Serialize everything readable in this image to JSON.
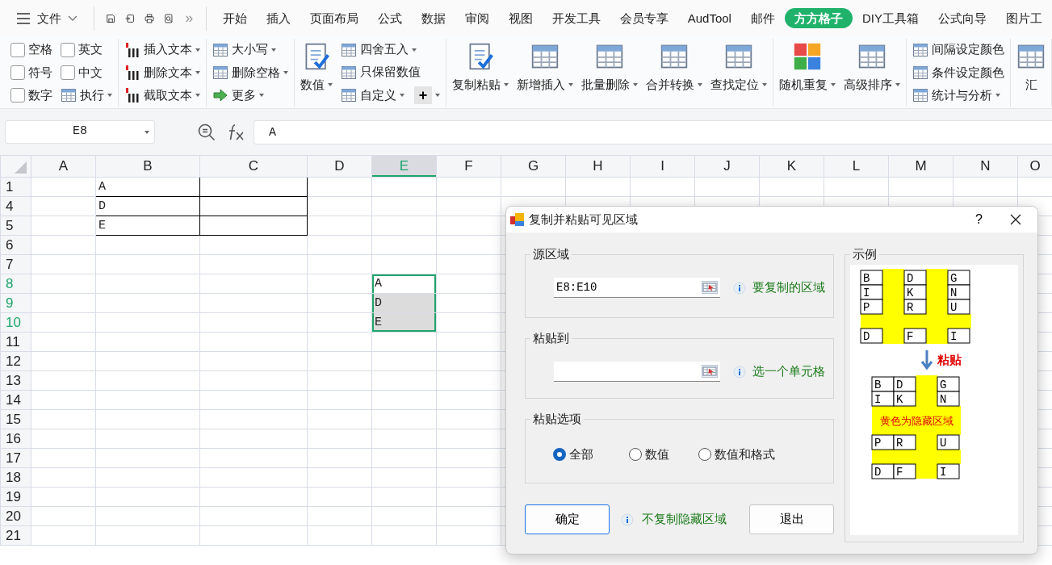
{
  "tab_bar": {
    "file_menu": "文件",
    "more": "»",
    "tabs": [
      {
        "label": "开始",
        "selected": false
      },
      {
        "label": "插入",
        "selected": false
      },
      {
        "label": "页面布局",
        "selected": false
      },
      {
        "label": "公式",
        "selected": false
      },
      {
        "label": "数据",
        "selected": false
      },
      {
        "label": "审阅",
        "selected": false
      },
      {
        "label": "视图",
        "selected": false
      },
      {
        "label": "开发工具",
        "selected": false
      },
      {
        "label": "会员专享",
        "selected": false
      },
      {
        "label": "AudTool",
        "selected": false
      },
      {
        "label": "邮件",
        "selected": false
      },
      {
        "label": "方方格子",
        "selected": true
      },
      {
        "label": "DIY工具箱",
        "selected": false
      },
      {
        "label": "公式向导",
        "selected": false
      },
      {
        "label": "图片工",
        "selected": false
      }
    ]
  },
  "ribbon": {
    "groups": [
      {
        "columns": [
          [
            {
              "kind": "check",
              "label": "空格",
              "checked": false
            },
            {
              "kind": "check",
              "label": "符号",
              "checked": false
            },
            {
              "kind": "check",
              "label": "数字",
              "checked": false
            }
          ],
          [
            {
              "kind": "check",
              "label": "英文",
              "checked": false
            },
            {
              "kind": "check",
              "label": "中文",
              "checked": false
            },
            {
              "kind": "small",
              "label": "执行",
              "dropdown": true
            }
          ]
        ]
      },
      {
        "columns": [
          [
            {
              "kind": "small",
              "label": "插入文本",
              "dropdown": true
            },
            {
              "kind": "small",
              "label": "删除文本",
              "dropdown": true
            },
            {
              "kind": "small",
              "label": "截取文本",
              "dropdown": true
            }
          ]
        ]
      },
      {
        "columns": [
          [
            {
              "kind": "small",
              "label": "大小写",
              "dropdown": true
            },
            {
              "kind": "small",
              "label": "删除空格",
              "dropdown": true
            },
            {
              "kind": "small",
              "label": "更多",
              "dropdown": true
            }
          ]
        ]
      },
      {
        "columns": [
          [
            {
              "kind": "large",
              "label": "数值",
              "dropdown": true
            }
          ],
          [
            {
              "kind": "small",
              "label": "四舍五入",
              "dropdown": true
            },
            {
              "kind": "small",
              "label": "只保留数值",
              "dropdown": false
            },
            {
              "kind": "pair",
              "items": [
                {
                  "kind": "small",
                  "label": "自定义",
                  "dropdown": true
                },
                {
                  "kind": "symbol",
                  "label": "+",
                  "dropdown": true
                }
              ]
            }
          ]
        ]
      },
      {
        "columns": [
          [
            {
              "kind": "large",
              "label": "复制粘贴",
              "dropdown": true
            }
          ],
          [
            {
              "kind": "large",
              "label": "新增插入",
              "dropdown": true
            }
          ],
          [
            {
              "kind": "large",
              "label": "批量删除",
              "dropdown": true
            }
          ],
          [
            {
              "kind": "large",
              "label": "合并转换",
              "dropdown": true
            }
          ],
          [
            {
              "kind": "large",
              "label": "查找定位",
              "dropdown": true
            }
          ]
        ]
      },
      {
        "columns": [
          [
            {
              "kind": "large",
              "label": "随机重复",
              "dropdown": true
            }
          ],
          [
            {
              "kind": "large",
              "label": "高级排序",
              "dropdown": true
            }
          ]
        ]
      },
      {
        "columns": [
          [
            {
              "kind": "small",
              "label": "间隔设定颜色",
              "dropdown": false
            },
            {
              "kind": "small",
              "label": "条件设定颜色",
              "dropdown": false
            },
            {
              "kind": "small",
              "label": "统计与分析",
              "dropdown": true
            }
          ]
        ]
      },
      {
        "columns": [
          [
            {
              "kind": "large",
              "label": "汇",
              "dropdown": false
            }
          ]
        ]
      }
    ]
  },
  "formula_bar": {
    "cell_name": "E8",
    "formula": "A"
  },
  "sheet": {
    "columns": [
      {
        "label": "A",
        "selected": false
      },
      {
        "label": "B",
        "selected": false
      },
      {
        "label": "C",
        "selected": false
      },
      {
        "label": "D",
        "selected": false
      },
      {
        "label": "E",
        "selected": true
      },
      {
        "label": "F",
        "selected": false
      },
      {
        "label": "G",
        "selected": false
      },
      {
        "label": "H",
        "selected": false
      },
      {
        "label": "I",
        "selected": false
      },
      {
        "label": "J",
        "selected": false
      },
      {
        "label": "K",
        "selected": false
      },
      {
        "label": "L",
        "selected": false
      },
      {
        "label": "M",
        "selected": false
      },
      {
        "label": "N",
        "selected": false
      },
      {
        "label": "O",
        "selected": false
      }
    ],
    "rows": [
      {
        "number": "1",
        "selected": false,
        "cells": [
          null,
          {
            "text": "A",
            "bordered": true
          },
          {
            "bordered": true
          }
        ]
      },
      {
        "number": "4",
        "selected": false,
        "cells": [
          null,
          {
            "text": "D",
            "bordered": true
          },
          {
            "bordered": true
          }
        ]
      },
      {
        "number": "5",
        "selected": false,
        "cells": [
          null,
          {
            "text": "E",
            "bordered": true
          },
          {
            "bordered": true
          }
        ]
      },
      {
        "number": "6",
        "selected": false
      },
      {
        "number": "7",
        "selected": false
      },
      {
        "number": "8",
        "selected": true,
        "cells": [
          null,
          null,
          null,
          null,
          {
            "text": "A",
            "active": true
          }
        ]
      },
      {
        "number": "9",
        "selected": true,
        "cells": [
          null,
          null,
          null,
          null,
          {
            "text": "D",
            "selected": true
          }
        ]
      },
      {
        "number": "10",
        "selected": true,
        "cells": [
          null,
          null,
          null,
          null,
          {
            "text": "E",
            "selected": true
          }
        ]
      },
      {
        "number": "11",
        "selected": false
      },
      {
        "number": "12",
        "selected": false
      },
      {
        "number": "13",
        "selected": false
      },
      {
        "number": "14",
        "selected": false
      },
      {
        "number": "15",
        "selected": false
      },
      {
        "number": "16",
        "selected": false
      },
      {
        "number": "17",
        "selected": false
      },
      {
        "number": "18",
        "selected": false
      },
      {
        "number": "19",
        "selected": false
      },
      {
        "number": "20",
        "selected": false
      },
      {
        "number": "21",
        "selected": false
      }
    ]
  },
  "dialog": {
    "title": "复制并粘贴可见区域",
    "help": "?",
    "fields": [
      {
        "legend": "源区域",
        "value": "E8:E10",
        "hint": "要复制的区域"
      },
      {
        "legend": "粘贴到",
        "hint": "选一个单元格"
      }
    ],
    "options": {
      "legend": "粘贴选项",
      "items": [
        {
          "label": "全部",
          "selected": true
        },
        {
          "label": "数值",
          "selected": false
        },
        {
          "label": "数值和格式",
          "selected": false
        }
      ]
    },
    "ok": "确定",
    "note": "不复制隐藏区域",
    "cancel": "退出",
    "example": {
      "legend": "示例",
      "before": [
        [
          "B",
          "D",
          "G"
        ],
        [
          "I",
          "K",
          "N"
        ],
        [
          "P",
          "R",
          "U"
        ],
        [
          "D",
          "F",
          "I"
        ]
      ],
      "paste_label": "粘贴",
      "after": [
        [
          "B",
          "D",
          "G"
        ],
        [
          "I",
          "K",
          "N"
        ],
        [
          "P",
          "R",
          "U"
        ],
        [
          "D",
          "F",
          "I"
        ]
      ],
      "hidden_note": "黄色为隐藏区域"
    }
  }
}
